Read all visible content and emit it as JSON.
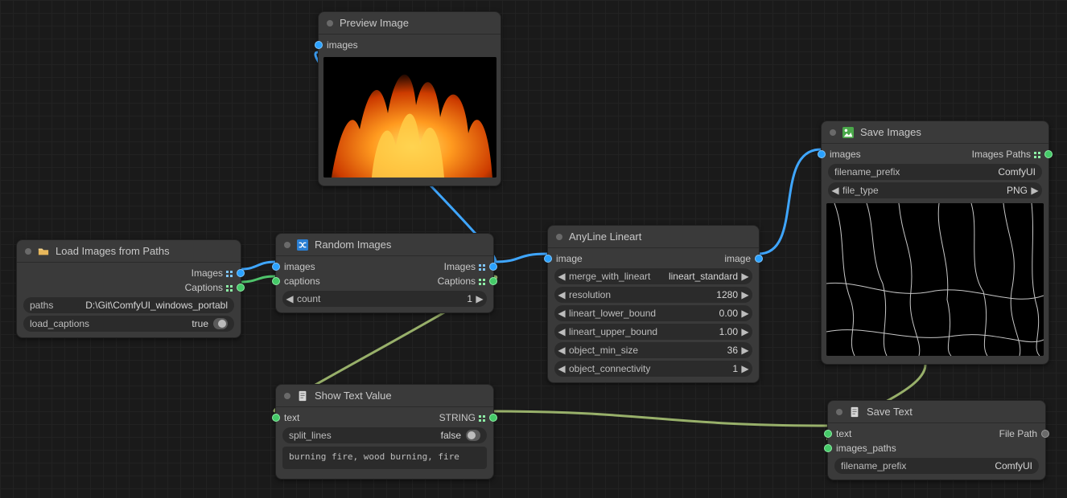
{
  "nodes": {
    "load": {
      "title": "Load Images from Paths",
      "outputs": {
        "images": "Images",
        "captions": "Captions"
      },
      "widgets": {
        "paths_label": "paths",
        "paths_value": "D:\\Git\\ComfyUI_windows_portabl",
        "load_captions_label": "load_captions",
        "load_captions_value": "true"
      }
    },
    "random": {
      "title": "Random Images",
      "inputs": {
        "images": "images",
        "captions": "captions"
      },
      "outputs": {
        "images": "Images",
        "captions": "Captions"
      },
      "widgets": {
        "count_label": "count",
        "count_value": "1"
      }
    },
    "preview": {
      "title": "Preview Image",
      "inputs": {
        "images": "images"
      }
    },
    "anyline": {
      "title": "AnyLine Lineart",
      "inputs": {
        "image": "image"
      },
      "outputs": {
        "image": "image"
      },
      "widgets": {
        "merge_label": "merge_with_lineart",
        "merge_value": "lineart_standard",
        "resolution_label": "resolution",
        "resolution_value": "1280",
        "lower_label": "lineart_lower_bound",
        "lower_value": "0.00",
        "upper_label": "lineart_upper_bound",
        "upper_value": "1.00",
        "minsize_label": "object_min_size",
        "minsize_value": "36",
        "conn_label": "object_connectivity",
        "conn_value": "1"
      }
    },
    "showtext": {
      "title": "Show Text Value",
      "inputs": {
        "text": "text"
      },
      "outputs": {
        "string": "STRING"
      },
      "widgets": {
        "split_label": "split_lines",
        "split_value": "false"
      },
      "content": "burning fire, wood burning, fire"
    },
    "saveimg": {
      "title": "Save Images",
      "inputs": {
        "images": "images"
      },
      "outputs": {
        "paths": "Images Paths"
      },
      "widgets": {
        "prefix_label": "filename_prefix",
        "prefix_value": "ComfyUI",
        "filetype_label": "file_type",
        "filetype_value": "PNG"
      }
    },
    "savetext": {
      "title": "Save Text",
      "inputs": {
        "text": "text",
        "images_paths": "images_paths"
      },
      "outputs": {
        "filepath": "File Path"
      },
      "widgets": {
        "prefix_label": "filename_prefix",
        "prefix_value": "ComfyUI"
      }
    }
  }
}
